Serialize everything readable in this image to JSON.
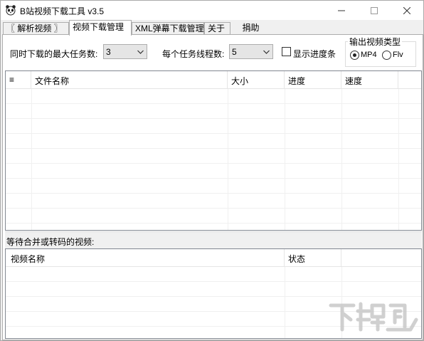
{
  "window": {
    "title": "B站视频下载工具 v3.5"
  },
  "tabs": [
    {
      "label": "〖 解析视频 〗"
    },
    {
      "label": "视频下载管理"
    },
    {
      "label": "XML弹幕下载管理"
    },
    {
      "label": "关于"
    },
    {
      "label": "捐助"
    }
  ],
  "settings": {
    "max_tasks_label": "同时下载的最大任务数:",
    "max_tasks_value": "3",
    "threads_label": "每个任务线程数:",
    "threads_value": "5",
    "show_progress_label": "显示进度条",
    "show_progress_checked": false,
    "output_group_title": "输出视频类型",
    "output_options": [
      {
        "label": "MP4",
        "checked": true
      },
      {
        "label": "Flv",
        "checked": false
      }
    ]
  },
  "download_list": {
    "columns": [
      "≡",
      "文件名称",
      "大小",
      "进度",
      "速度"
    ]
  },
  "pending_section": {
    "label": "等待合并或转码的视频:",
    "columns": [
      "视频名称",
      "状态"
    ]
  },
  "watermark": {
    "text": "下载吧"
  }
}
